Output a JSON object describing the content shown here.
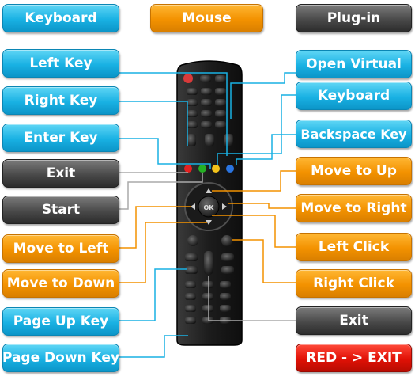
{
  "header": {
    "keyboard": "Keyboard",
    "mouse": "Mouse",
    "plugin": "Plug-in"
  },
  "left_labels": {
    "left_key": "Left Key",
    "right_key": "Right Key",
    "enter_key": "Enter Key",
    "exit": "Exit",
    "start": "Start",
    "move_to_left": "Move to Left",
    "move_to_down": "Move to Down",
    "page_up_key": "Page Up Key",
    "page_down_key": "Page Down Key"
  },
  "right_labels": {
    "open_virtual": "Open Virtual",
    "keyboard": "Keyboard",
    "backspace_key": "Backspace Key",
    "move_to_up": "Move to Up",
    "move_to_right": "Move to Right",
    "left_click": "Left Click",
    "right_click": "Right Click",
    "exit": "Exit",
    "red_exit": "RED - > EXIT"
  },
  "remote": {
    "ok_label": "OK"
  },
  "colors": {
    "keyboard_blue": "#19b1e3",
    "mouse_orange": "#f39200",
    "plugin_gray": "#4a4a4a",
    "exit_red": "#e11106"
  }
}
